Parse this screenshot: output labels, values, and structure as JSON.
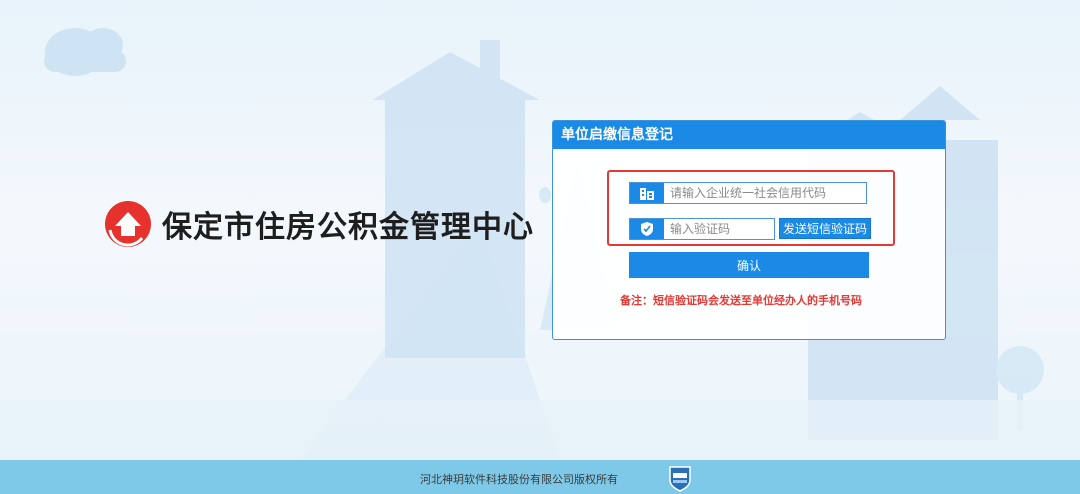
{
  "brand": {
    "logo_icon": "house-arrow-logo-icon",
    "name": "保定市住房公积金管理中心"
  },
  "panel": {
    "title": "单位启缴信息登记",
    "credit_code_placeholder": "请输入企业统一社会信用代码",
    "credit_code_value": "",
    "captcha_placeholder": "输入验证码",
    "captcha_value": "",
    "send_sms_label": "发送短信验证码",
    "confirm_label": "确认",
    "note": "备注：短信验证码会发送至单位经办人的手机号码"
  },
  "footer": {
    "copyright": "河北神玥软件科技股份有限公司版权所有",
    "badge_icon": "police-badge-icon"
  },
  "colors": {
    "accent": "#1a8ae6",
    "highlight": "#e53935",
    "footer_bg": "#7fc9e8",
    "logo_red": "#e6312d"
  }
}
